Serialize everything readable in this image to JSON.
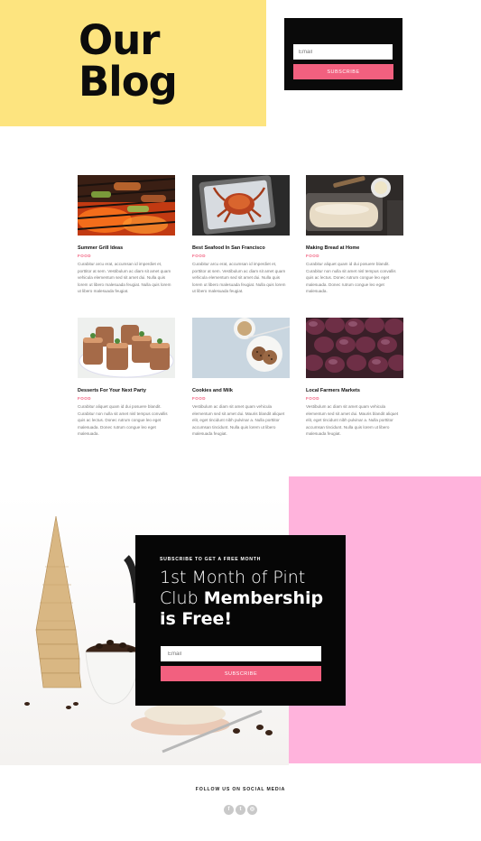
{
  "header": {
    "title_line1": "Our",
    "title_line2": "Blog",
    "subscribe": {
      "email_placeholder": "Email",
      "button_label": "SUBSCRIBE"
    }
  },
  "posts": [
    {
      "title": "Summer Grill Ideas",
      "category": "FOOD",
      "excerpt": "Curabitur arcu erat, accumsan id imperdiet et, porttitor at sem. Vestibulum ac diam sit amet quam vehicula elementum sed sit amet dui. Nulla quis lorem ut libero malesuada feugiat. Nulla quis lorem ut libero malesuada feugiat."
    },
    {
      "title": "Best Seafood In San Francisco",
      "category": "FOOD",
      "excerpt": "Curabitur arcu erat, accumsan id imperdiet et, porttitor at sem. Vestibulum ac diam sit amet quam vehicula elementum sed sit amet dui. Nulla quis lorem ut libero malesuada feugiat. Nulla quis lorem ut libero malesuada feugiat."
    },
    {
      "title": "Making Bread at Home",
      "category": "FOOD",
      "excerpt": "Curabitur aliquet quam id dui posuere blandit. Curabitur non nulla sit amet nisl tempus convallis quis ac lectus. Donec rutrum congue leo eget malesuada. Donec rutrum congue leo eget malesuada."
    },
    {
      "title": "Desserts For Your Next Party",
      "category": "FOOD",
      "excerpt": "Curabitur aliquet quam id dui posuere blandit. Curabitur non nulla sit amet nisl tempus convallis quis ac lectus. Donec rutrum congue leo eget malesuada. Donec rutrum congue leo eget malesuada."
    },
    {
      "title": "Cookies and Milk",
      "category": "FOOD",
      "excerpt": "Vestibulum ac diam sit amet quam vehicula elementum sed sit amet dui. Mauris blandit aliquet elit, eget tincidunt nibh pulvinar a. Nulla porttitor accumsan tincidunt. Nulla quis lorem ut libero malesuada feugiat."
    },
    {
      "title": "Local Farmers Markets",
      "category": "FOOD",
      "excerpt": "Vestibulum ac diam sit amet quam vehicula elementum sed sit amet dui. Mauris blandit aliquet elit, eget tincidunt nibh pulvinar a. Nulla porttitor accumsan tincidunt. Nulla quis lorem ut libero malesuada feugiat."
    }
  ],
  "promo": {
    "kicker": "SUBSCRIBE TO GET A FREE MONTH",
    "headline_light": "1st Month of Pint Club ",
    "headline_bold1": "Membership",
    "headline_bold2": "is Free!",
    "email_placeholder": "Email",
    "button_label": "SUBSCRIBE"
  },
  "footer": {
    "follow_text": "FOLLOW US ON SOCIAL MEDIA",
    "social": [
      {
        "icon": "facebook-icon",
        "glyph": "f"
      },
      {
        "icon": "twitter-icon",
        "glyph": "t"
      },
      {
        "icon": "instagram-icon",
        "glyph": "◎"
      }
    ]
  },
  "colors": {
    "yellow": "#fde47f",
    "pink_bg": "#ffb3dc",
    "accent": "#f2607f",
    "dark": "#0a0a0a"
  }
}
